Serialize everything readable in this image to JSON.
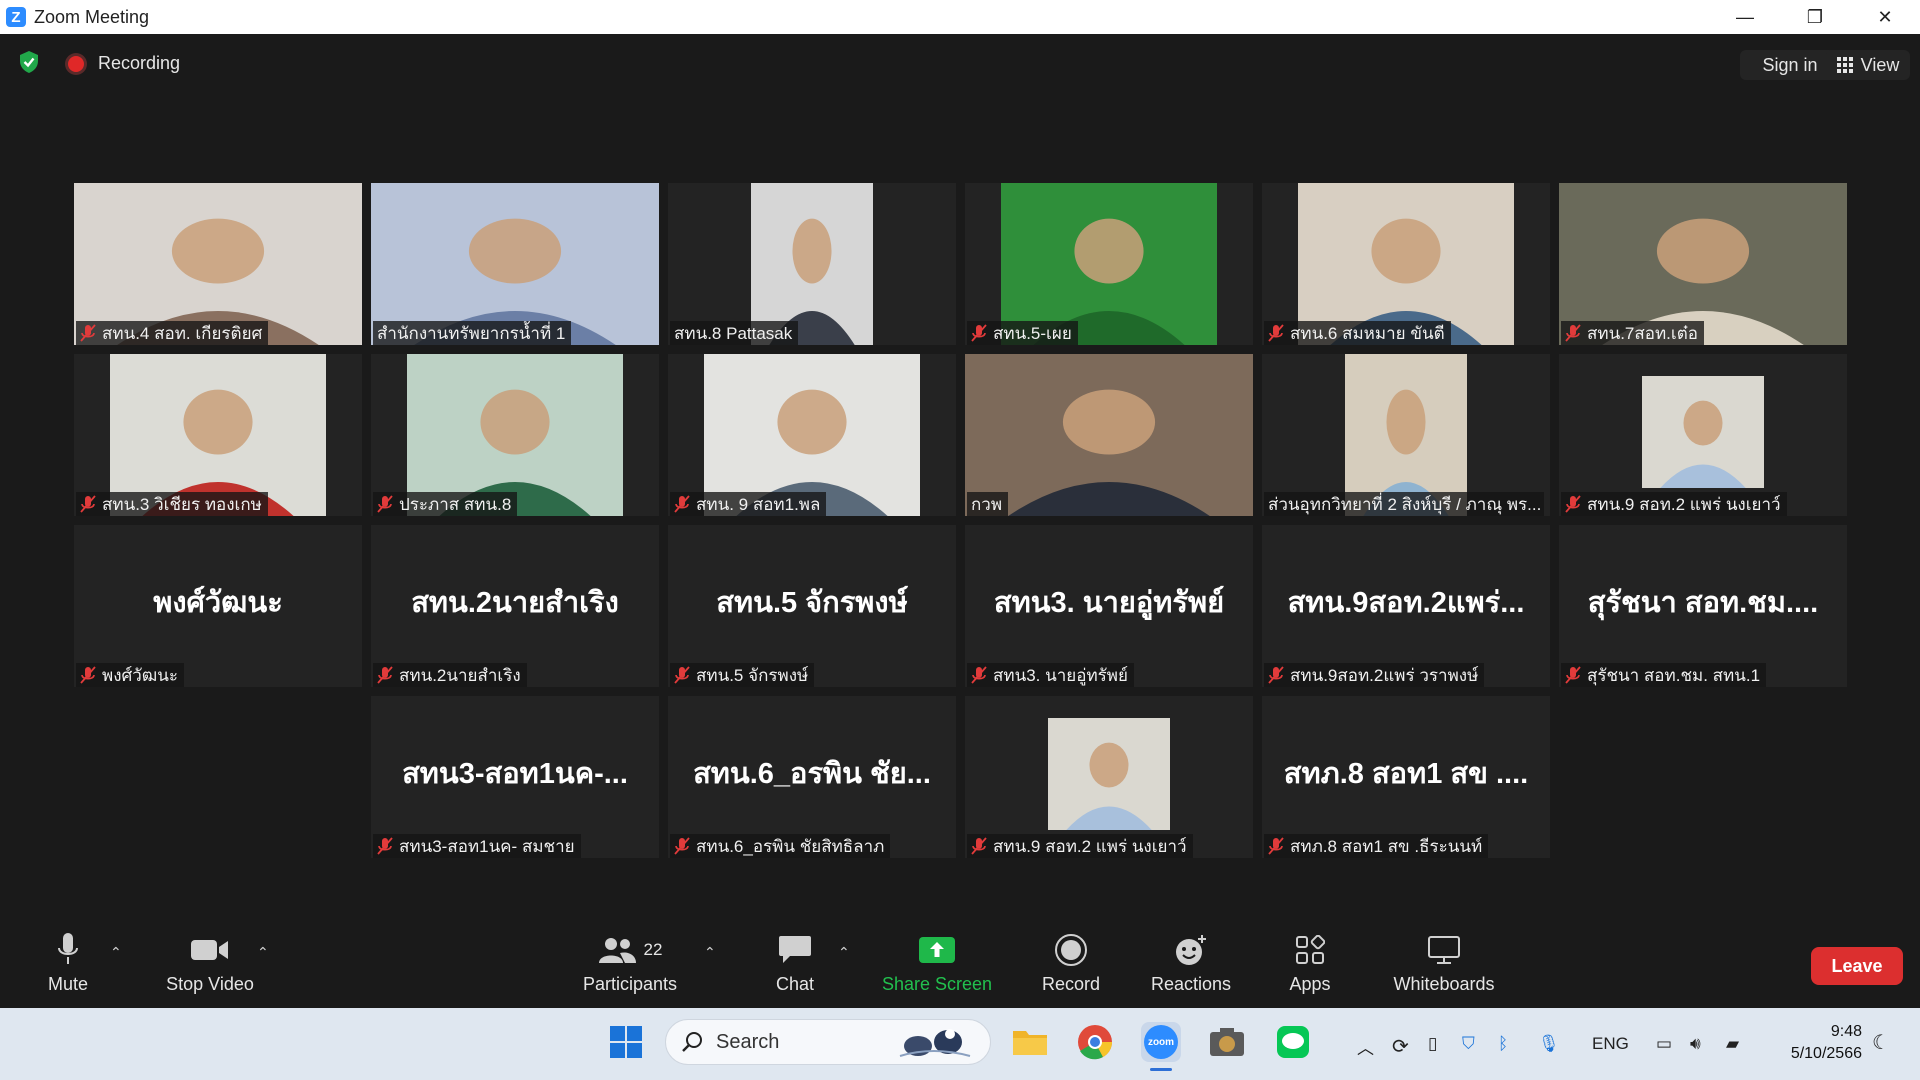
{
  "window": {
    "title": "Zoom Meeting",
    "minimize": "—",
    "restore": "❐",
    "close": "✕"
  },
  "topbar": {
    "recording": "Recording",
    "sign_in": "Sign in",
    "view": "View",
    "shield_color": "#21a84a"
  },
  "tiles": [
    {
      "label": "สทน.4 สอท. เกียรติยศ",
      "muted": true,
      "type": "video",
      "bg": "#d9d4cf",
      "fg": "#8a7060"
    },
    {
      "label": "สำนักงานทรัพยากรน้ำที่ 1",
      "muted": false,
      "type": "video",
      "bg": "#b8c3d8",
      "fg": "#6b7fa6"
    },
    {
      "label": "สทน.8 Pattasak",
      "muted": false,
      "type": "video",
      "bg": "#d6d6d6",
      "fg": "#3a3f4a"
    },
    {
      "label": "สทน.5-เผย",
      "muted": true,
      "type": "video",
      "bg": "#2f8f3a",
      "fg": "#1f6a2a"
    },
    {
      "label": "สทน.6 สมหมาย  ขันตี",
      "muted": true,
      "type": "video",
      "bg": "#d8cfc2",
      "fg": "#4a6a8a"
    },
    {
      "label": "สทน.7สอท.เต๋อ",
      "muted": true,
      "type": "video",
      "bg": "#6a6a5a",
      "fg": "#d8d0c0"
    },
    {
      "label": "สทน.3 วิเชียร ทองเกษ",
      "muted": true,
      "type": "video",
      "bg": "#dcdcd6",
      "fg": "#c0322d"
    },
    {
      "label": "ประภาส สทน.8",
      "muted": true,
      "type": "video",
      "bg": "#bdd2c5",
      "fg": "#2e6b4a"
    },
    {
      "label": "สทน. 9 สอท1.พล",
      "muted": true,
      "type": "video",
      "bg": "#e3e3e0",
      "fg": "#5a6a7a"
    },
    {
      "label": "กวพ",
      "muted": false,
      "type": "video",
      "active": true,
      "bg": "#7d6a5a",
      "fg": "#2a2f3a"
    },
    {
      "label": "ส่วนอุทกวิทยาที่ 2 สิงห์บุรี / ภาณุ พร...",
      "muted": false,
      "type": "video",
      "bg": "#d6cdbd",
      "fg": "#8fb3d0"
    },
    {
      "label": "สทน.9 สอท.2 แพร่ นงเยาว์",
      "muted": true,
      "type": "video",
      "bg": "#dad8d0",
      "fg": "#a8c0dc"
    },
    {
      "label": "พงศ์วัฒนะ",
      "muted": true,
      "type": "name",
      "display": "พงศ์วัฒนะ"
    },
    {
      "label": "สทน.2นายสำเริง",
      "muted": true,
      "type": "name",
      "display": "สทน.2นายสำเริง"
    },
    {
      "label": "สทน.5 จักรพงษ์",
      "muted": true,
      "type": "name",
      "display": "สทน.5 จักรพงษ์"
    },
    {
      "label": "สทน3. นายอู่ทรัพย์",
      "muted": true,
      "type": "name",
      "display": "สทน3. นายอู่ทรัพย์"
    },
    {
      "label": "สทน.9สอท.2แพร่ วราพงษ์",
      "muted": true,
      "type": "name",
      "display": "สทน.9สอท.2แพร่..."
    },
    {
      "label": "สุรัชนา สอท.ชม. สทน.1",
      "muted": true,
      "type": "name",
      "display": "สุรัชนา สอท.ชม...."
    },
    {
      "label": "สทน3-สอท1นค- สมชาย",
      "muted": true,
      "type": "name",
      "display": "สทน3-สอท1นค-..."
    },
    {
      "label": "สทน.6_อรพิน ชัยสิทธิลาภ",
      "muted": true,
      "type": "name",
      "display": "สทน.6_อรพิน ชัย..."
    },
    {
      "label": "สทน.9 สอท.2 แพร่ นงเยาว์",
      "muted": true,
      "type": "video",
      "bg": "#dad8d0",
      "fg": "#a8c0dc"
    },
    {
      "label": "สทภ.8 สอท1 สข .ธีระนนท์",
      "muted": true,
      "type": "name",
      "display": "สทภ.8 สอท1 สข ...."
    }
  ],
  "controls": {
    "mute": "Mute",
    "stop_video": "Stop Video",
    "participants": "Participants",
    "participants_count": "22",
    "chat": "Chat",
    "share_screen": "Share Screen",
    "record": "Record",
    "reactions": "Reactions",
    "apps": "Apps",
    "whiteboards": "Whiteboards",
    "leave": "Leave"
  },
  "taskbar": {
    "search": "Search",
    "lang": "ENG",
    "time": "9:48",
    "date": "5/10/2566",
    "zoom_label": "zoom"
  }
}
